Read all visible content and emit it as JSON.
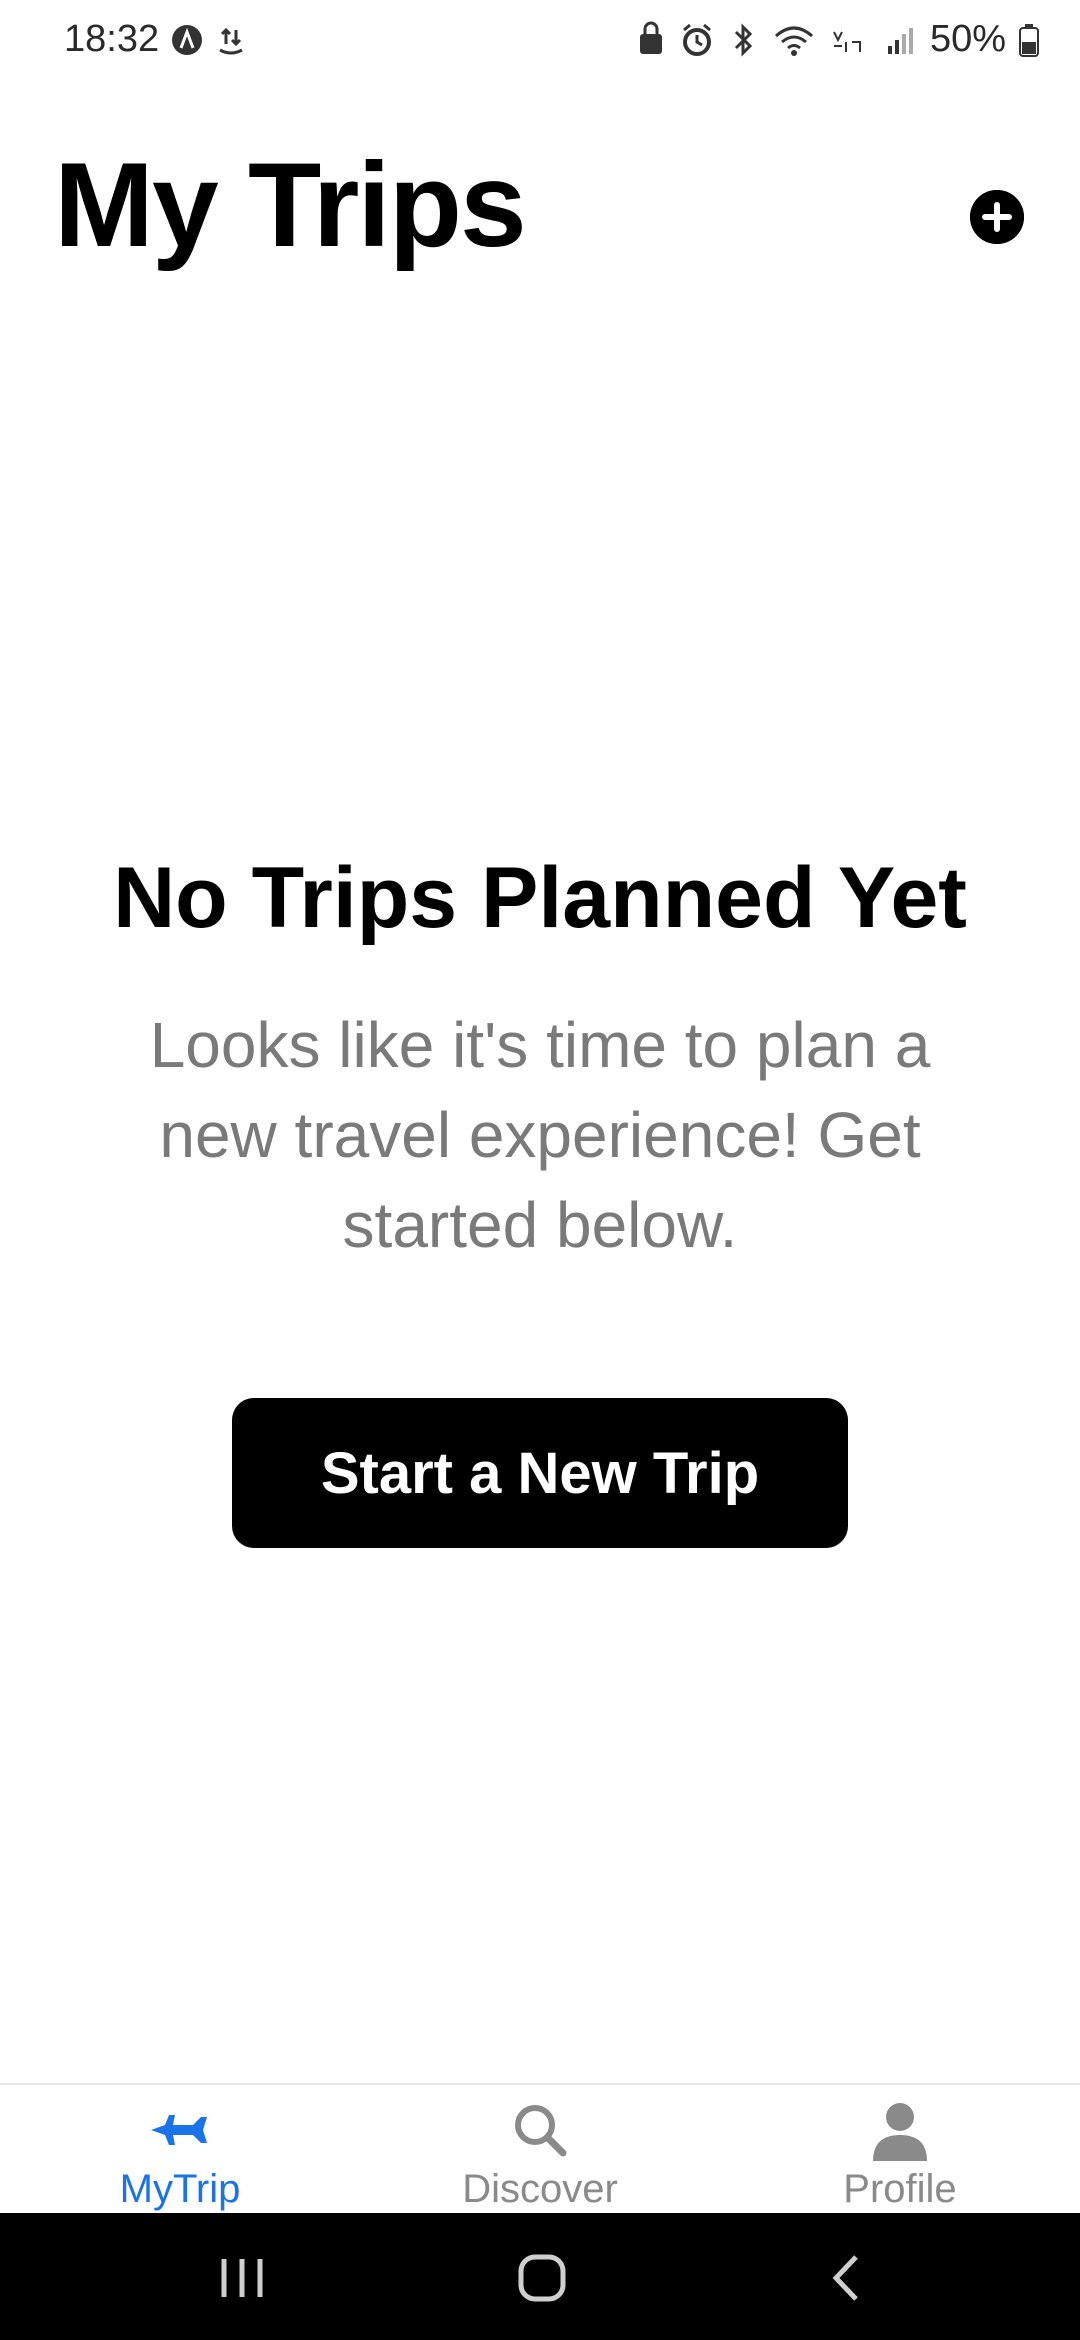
{
  "status_bar": {
    "time": "18:32",
    "battery": "50%",
    "icons": [
      "app-notification-icon",
      "transfer-icon",
      "lock-icon",
      "alarm-icon",
      "bluetooth-icon",
      "wifi-icon",
      "volte-icon",
      "signal-icon",
      "battery-icon"
    ]
  },
  "header": {
    "title": "My Trips",
    "add_icon": "plus-circle-icon"
  },
  "empty_state": {
    "title": "No Trips Planned Yet",
    "description": "Looks like it's time to plan a new travel experience! Get started below.",
    "button_label": "Start a New Trip"
  },
  "tabs": [
    {
      "label": "MyTrip",
      "icon": "airplane-icon",
      "active": true
    },
    {
      "label": "Discover",
      "icon": "search-icon",
      "active": false
    },
    {
      "label": "Profile",
      "icon": "person-icon",
      "active": false
    }
  ],
  "colors": {
    "accent": "#1a73e8",
    "inactive": "#8a8a8a",
    "primary": "#000000",
    "muted_text": "#7a7a7a"
  },
  "system_nav": [
    "recents-button",
    "home-button",
    "back-button"
  ]
}
